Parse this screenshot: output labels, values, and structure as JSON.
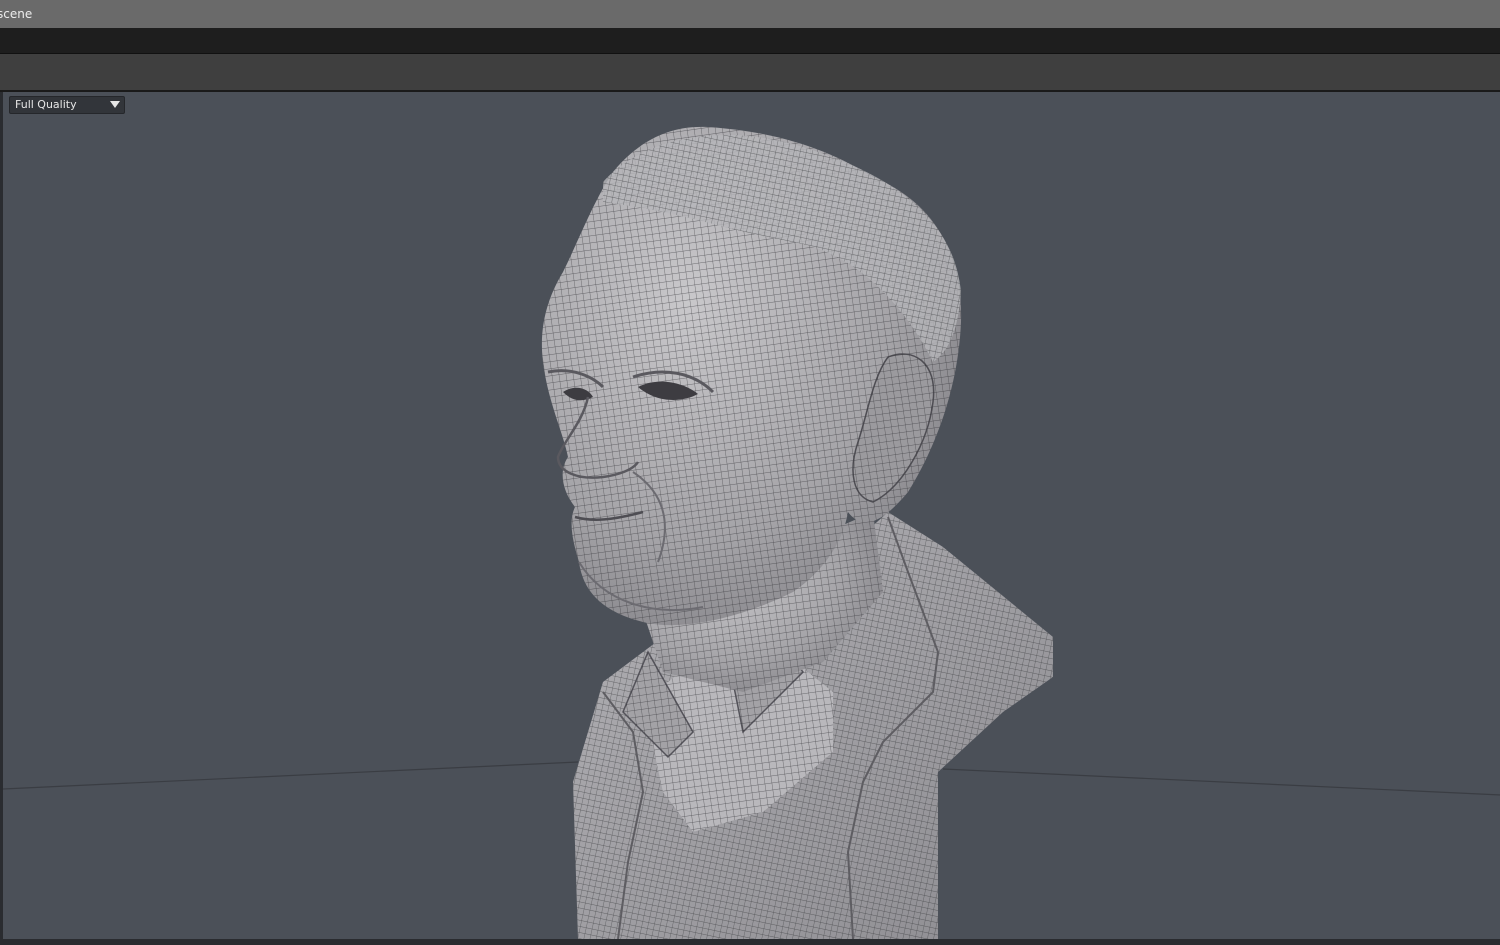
{
  "window": {
    "title": "scene"
  },
  "viewport": {
    "quality_dropdown": {
      "selected": "Full Quality"
    }
  },
  "colors": {
    "titlebar": "#6a6a6a",
    "menubar": "#1e1e1e",
    "toolbar": "#3f3f3f",
    "viewport_background": "#4b5058",
    "mesh_surface": "#a9a8ab",
    "wire": "#2a2b2e"
  },
  "icons": {
    "dropdown": "chevron-down-icon"
  }
}
